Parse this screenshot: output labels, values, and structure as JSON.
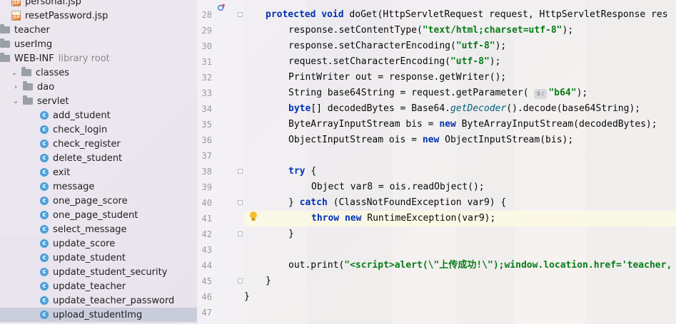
{
  "tree": {
    "items": [
      {
        "label": "personal.jsp",
        "kind": "jsp",
        "indent": 2
      },
      {
        "label": "resetPassword.jsp",
        "kind": "jsp",
        "indent": 2
      },
      {
        "label": "teacher",
        "kind": "folder",
        "indent": 0
      },
      {
        "label": "userImg",
        "kind": "folder",
        "indent": 0
      },
      {
        "label": "WEB-INF",
        "kind": "folder",
        "indent": 0,
        "note": "library root"
      },
      {
        "label": "classes",
        "kind": "folder",
        "indent": 1,
        "expanded": true
      },
      {
        "label": "dao",
        "kind": "folder",
        "indent": 2,
        "collapsed": true
      },
      {
        "label": "servlet",
        "kind": "folder",
        "indent": 2,
        "expanded": true
      },
      {
        "label": "add_student",
        "kind": "class",
        "indent": 3
      },
      {
        "label": "check_login",
        "kind": "class",
        "indent": 3
      },
      {
        "label": "check_register",
        "kind": "class",
        "indent": 3
      },
      {
        "label": "delete_student",
        "kind": "class",
        "indent": 3
      },
      {
        "label": "exit",
        "kind": "class",
        "indent": 3
      },
      {
        "label": "message",
        "kind": "class",
        "indent": 3
      },
      {
        "label": "one_page_score",
        "kind": "class",
        "indent": 3
      },
      {
        "label": "one_page_student",
        "kind": "class",
        "indent": 3
      },
      {
        "label": "select_message",
        "kind": "class",
        "indent": 3
      },
      {
        "label": "update_score",
        "kind": "class",
        "indent": 3
      },
      {
        "label": "update_student",
        "kind": "class",
        "indent": 3
      },
      {
        "label": "update_student_security",
        "kind": "class",
        "indent": 3
      },
      {
        "label": "update_teacher",
        "kind": "class",
        "indent": 3
      },
      {
        "label": "update_teacher_password",
        "kind": "class",
        "indent": 3
      },
      {
        "label": "upload_studentImg",
        "kind": "class",
        "indent": 3,
        "selected": true
      }
    ]
  },
  "editor": {
    "lines": [
      {
        "num": "28",
        "indent": 1,
        "tokens": [
          [
            "kw",
            "protected "
          ],
          [
            "kw",
            "void "
          ],
          [
            "",
            "doGet(HttpServletRequest request, HttpServletResponse res"
          ]
        ]
      },
      {
        "num": "29",
        "indent": 2,
        "tokens": [
          [
            "",
            "response.setContentType("
          ],
          [
            "str",
            "\"text/html;charset=utf-8\""
          ],
          [
            "",
            ");"
          ]
        ]
      },
      {
        "num": "30",
        "indent": 2,
        "tokens": [
          [
            "",
            "response.setCharacterEncoding("
          ],
          [
            "str",
            "\"utf-8\""
          ],
          [
            "",
            ");"
          ]
        ]
      },
      {
        "num": "31",
        "indent": 2,
        "tokens": [
          [
            "",
            "request.setCharacterEncoding("
          ],
          [
            "str",
            "\"utf-8\""
          ],
          [
            "",
            ");"
          ]
        ]
      },
      {
        "num": "32",
        "indent": 2,
        "tokens": [
          [
            "",
            "PrintWriter out = response.getWriter();"
          ]
        ]
      },
      {
        "num": "33",
        "indent": 2,
        "tokens": [
          [
            "",
            "String base64String = request.getParameter( "
          ],
          [
            "hint",
            "s:"
          ],
          [
            "str",
            "\"b64\""
          ],
          [
            "",
            ");"
          ]
        ]
      },
      {
        "num": "34",
        "indent": 2,
        "tokens": [
          [
            "kw",
            "byte"
          ],
          [
            "",
            "[] decodedBytes = Base64."
          ],
          [
            "it",
            "getDecoder"
          ],
          [
            "",
            "().decode(base64String);"
          ]
        ]
      },
      {
        "num": "35",
        "indent": 2,
        "tokens": [
          [
            "",
            "ByteArrayInputStream bis = "
          ],
          [
            "kw",
            "new "
          ],
          [
            "",
            "ByteArrayInputStream(decodedBytes);"
          ]
        ]
      },
      {
        "num": "36",
        "indent": 2,
        "tokens": [
          [
            "",
            "ObjectInputStream ois = "
          ],
          [
            "kw",
            "new "
          ],
          [
            "",
            "ObjectInputStream(bis);"
          ]
        ]
      },
      {
        "num": "37",
        "indent": 0,
        "tokens": []
      },
      {
        "num": "38",
        "indent": 2,
        "tokens": [
          [
            "kw",
            "try "
          ],
          [
            "",
            "{"
          ]
        ]
      },
      {
        "num": "39",
        "indent": 3,
        "tokens": [
          [
            "",
            "Object var8 = ois.readObject();"
          ]
        ]
      },
      {
        "num": "40",
        "indent": 2,
        "tokens": [
          [
            "",
            "} "
          ],
          [
            "kw",
            "catch "
          ],
          [
            "",
            "(ClassNotFoundException var9) {"
          ]
        ]
      },
      {
        "num": "41",
        "indent": 3,
        "highlight": true,
        "tokens": [
          [
            "kw",
            "throw "
          ],
          [
            "kw",
            "new "
          ],
          [
            "",
            "RuntimeException(var9);"
          ]
        ]
      },
      {
        "num": "42",
        "indent": 2,
        "tokens": [
          [
            "",
            "}"
          ]
        ]
      },
      {
        "num": "43",
        "indent": 0,
        "tokens": []
      },
      {
        "num": "44",
        "indent": 2,
        "tokens": [
          [
            "",
            "out.print("
          ],
          [
            "str",
            "\"<script>alert(\\\"上传成功!\\\");window.location.href='teacher,"
          ]
        ]
      },
      {
        "num": "45",
        "indent": 1,
        "tokens": [
          [
            "",
            "}"
          ]
        ]
      },
      {
        "num": "46",
        "indent": 0,
        "tokens": [
          [
            "",
            "}"
          ]
        ]
      },
      {
        "num": "47",
        "indent": 0,
        "tokens": []
      }
    ]
  },
  "colors": {
    "keyword": "#0033b3",
    "string": "#067d17",
    "class_icon": "#4f9fd8",
    "selection": "#bec6d6",
    "line_highlight": "#fcfae3"
  }
}
